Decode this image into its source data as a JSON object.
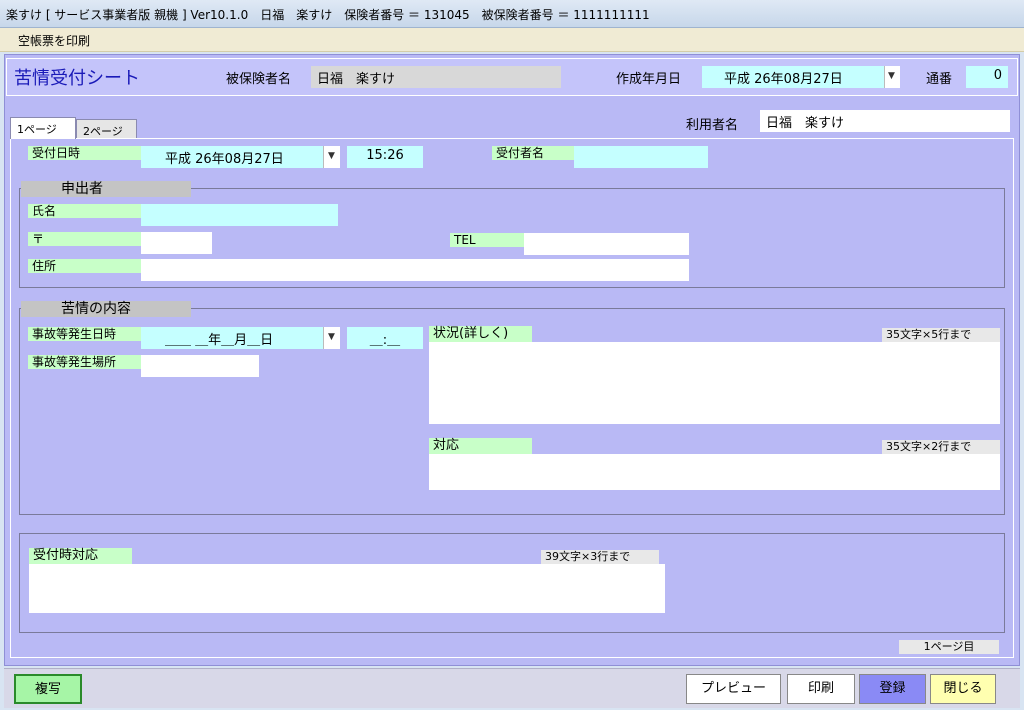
{
  "window": {
    "title": "楽すけ [ サービス事業者版 親機 ] Ver10.1.0　日福　楽すけ　保険者番号 ＝ 131045　被保険者番号 ＝ 1111111111"
  },
  "menu": {
    "print_blank": "空帳票を印刷"
  },
  "header": {
    "app_title": "苦情受付シート",
    "insured_label": "被保険者名",
    "insured_value": "日福　楽すけ",
    "created_label": "作成年月日",
    "created_value": "平成 26年08月27日",
    "serial_label": "通番",
    "serial_value": "0"
  },
  "tabs": {
    "page1": "1ページ",
    "page2": "2ページ"
  },
  "user": {
    "label": "利用者名",
    "value": "日福　楽すけ"
  },
  "reception": {
    "date_label": "受付日時",
    "date_value": "平成 26年08月27日",
    "time_value": "15:26",
    "receiver_label": "受付者名",
    "receiver_value": ""
  },
  "applicant": {
    "group_title": "申出者",
    "name_label": "氏名",
    "postal_label": "〒",
    "tel_label": "TEL",
    "address_label": "住所"
  },
  "complaint": {
    "group_title": "苦情の内容",
    "incident_date_label": "事故等発生日時",
    "incident_date_value": "＿＿ ＿年＿月＿日",
    "incident_time_value": "＿:＿",
    "incident_place_label": "事故等発生場所",
    "situation_label": "状況(詳しく)",
    "situation_note": "35文字×5行まで",
    "response_label": "対応",
    "response_note": "35文字×2行まで"
  },
  "reception_response": {
    "label": "受付時対応",
    "note": "39文字×3行まで"
  },
  "page_indicator": "1ページ目",
  "buttons": {
    "copy": "複写",
    "preview": "プレビュー",
    "print": "印刷",
    "register": "登録",
    "close": "閉じる"
  },
  "icons": {
    "dropdown": "dropdown-arrow-icon"
  }
}
